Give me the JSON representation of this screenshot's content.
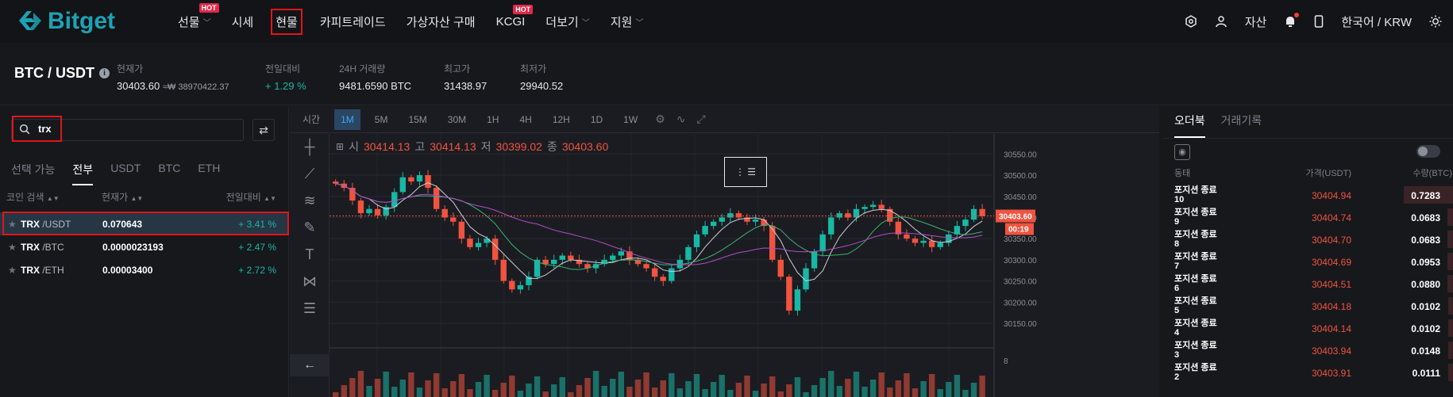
{
  "brand": "Bitget",
  "nav": {
    "items": [
      {
        "label": "선물",
        "dropdown": true,
        "hot": true
      },
      {
        "label": "시세",
        "dropdown": false,
        "hot": false
      },
      {
        "label": "현물",
        "dropdown": false,
        "hot": false,
        "active": true
      },
      {
        "label": "카피트레이드",
        "dropdown": false,
        "hot": false
      },
      {
        "label": "가상자산 구매",
        "dropdown": false,
        "hot": false
      },
      {
        "label": "KCGI",
        "dropdown": false,
        "hot": true
      },
      {
        "label": "더보기",
        "dropdown": true,
        "hot": false
      },
      {
        "label": "지원",
        "dropdown": true,
        "hot": false
      }
    ],
    "hot_label": "HOT",
    "assets": "자산",
    "language": "한국어 / KRW"
  },
  "ticker": {
    "pair": "BTC / USDT",
    "price_label": "현재가",
    "price": "30403.60",
    "price_krw": "≈₩ 38970422.37",
    "change_label": "전일대비",
    "change": "+ 1.29 %",
    "volume_label": "24H 거래량",
    "volume": "9481.6590 BTC",
    "high_label": "최고가",
    "high": "31438.97",
    "low_label": "최저가",
    "low": "29940.52"
  },
  "left": {
    "search_value": "trx",
    "tabs": [
      "선택 가능",
      "전부",
      "USDT",
      "BTC",
      "ETH"
    ],
    "active_tab": 1,
    "headers": {
      "coin": "코인 검색",
      "price": "현재가",
      "change": "전일대비"
    },
    "rows": [
      {
        "base": "TRX",
        "quote": "/USDT",
        "price": "0.070643",
        "change": "+ 3.41 %"
      },
      {
        "base": "TRX",
        "quote": "/BTC",
        "price": "0.0000023193",
        "change": "+ 2.47 %"
      },
      {
        "base": "TRX",
        "quote": "/ETH",
        "price": "0.00003400",
        "change": "+ 2.72 %"
      }
    ]
  },
  "chart": {
    "toolbar": [
      "시간",
      "1M",
      "5M",
      "15M",
      "30M",
      "1H",
      "4H",
      "12H",
      "1D",
      "1W"
    ],
    "active_interval": "1M",
    "ohlc": {
      "o_label": "시",
      "o": "30414.13",
      "h_label": "고",
      "h": "30414.13",
      "l_label": "저",
      "l": "30399.02",
      "c_label": "종",
      "c": "30403.60"
    },
    "current_price_tag": "30403.60",
    "countdown_tag": "00:19",
    "volume_axis_tick": "8"
  },
  "chart_data": {
    "type": "line",
    "title": "",
    "xlabel": "",
    "ylabel": "",
    "ylim": [
      30120,
      30560
    ],
    "yticks": [
      "30550.00",
      "30500.00",
      "30450.00",
      "30400.00",
      "30350.00",
      "30300.00",
      "30250.00",
      "30200.00",
      "30150.00"
    ],
    "ytick_values": [
      30550,
      30500,
      30450,
      30400,
      30350,
      30300,
      30250,
      30200,
      30150
    ],
    "close": [
      30480,
      30470,
      30440,
      30410,
      30420,
      30405,
      30425,
      30460,
      30495,
      30485,
      30500,
      30470,
      30420,
      30400,
      30390,
      30350,
      30330,
      30340,
      30350,
      30300,
      30250,
      30230,
      30240,
      30260,
      30300,
      30290,
      30300,
      30310,
      30300,
      30290,
      30280,
      30290,
      30300,
      30310,
      30320,
      30300,
      30290,
      30280,
      30260,
      30250,
      30280,
      30300,
      30330,
      30360,
      30380,
      30390,
      30400,
      30410,
      30400,
      30390,
      30395,
      30380,
      30300,
      30260,
      30180,
      30230,
      30280,
      30320,
      30360,
      30400,
      30410,
      30400,
      30420,
      30425,
      30430,
      30420,
      30390,
      30360,
      30350,
      30340,
      30345,
      30330,
      30340,
      30360,
      30380,
      30395,
      30420,
      30403
    ],
    "series": [
      {
        "name": "",
        "color": "#17b8a6",
        "values_role": "up candles"
      },
      {
        "name": "",
        "color": "#f0533f",
        "values_role": "down candles"
      }
    ],
    "grid": true
  },
  "orderbook": {
    "tabs": [
      "오더북",
      "거래기록"
    ],
    "headers": {
      "status": "동태",
      "price": "가격(USDT)",
      "qty": "수량(BTC)"
    },
    "rows": [
      {
        "status": "포지션 종료",
        "num": "10",
        "price": "30404.94",
        "qty": "0.7283",
        "depth": 0.17
      },
      {
        "status": "포지션 종료",
        "num": "9",
        "price": "30404.74",
        "qty": "0.0683",
        "depth": 0.02
      },
      {
        "status": "포지션 종료",
        "num": "8",
        "price": "30404.70",
        "qty": "0.0683",
        "depth": 0.02
      },
      {
        "status": "포지션 종료",
        "num": "7",
        "price": "30404.69",
        "qty": "0.0953",
        "depth": 0.02
      },
      {
        "status": "포지션 종료",
        "num": "6",
        "price": "30404.51",
        "qty": "0.0880",
        "depth": 0.02
      },
      {
        "status": "포지션 종료",
        "num": "5",
        "price": "30404.18",
        "qty": "0.0102",
        "depth": 0.005
      },
      {
        "status": "포지션 종료",
        "num": "4",
        "price": "30404.14",
        "qty": "0.0102",
        "depth": 0.005
      },
      {
        "status": "포지션 종료",
        "num": "3",
        "price": "30403.94",
        "qty": "0.0148",
        "depth": 0.005
      },
      {
        "status": "포지션 종료",
        "num": "2",
        "price": "30403.91",
        "qty": "0.0111",
        "depth": 0.005
      }
    ]
  },
  "colors": {
    "accent": "#1da2b4",
    "up": "#17b8a6",
    "down": "#f0533f",
    "highlight": "#e0151a"
  }
}
